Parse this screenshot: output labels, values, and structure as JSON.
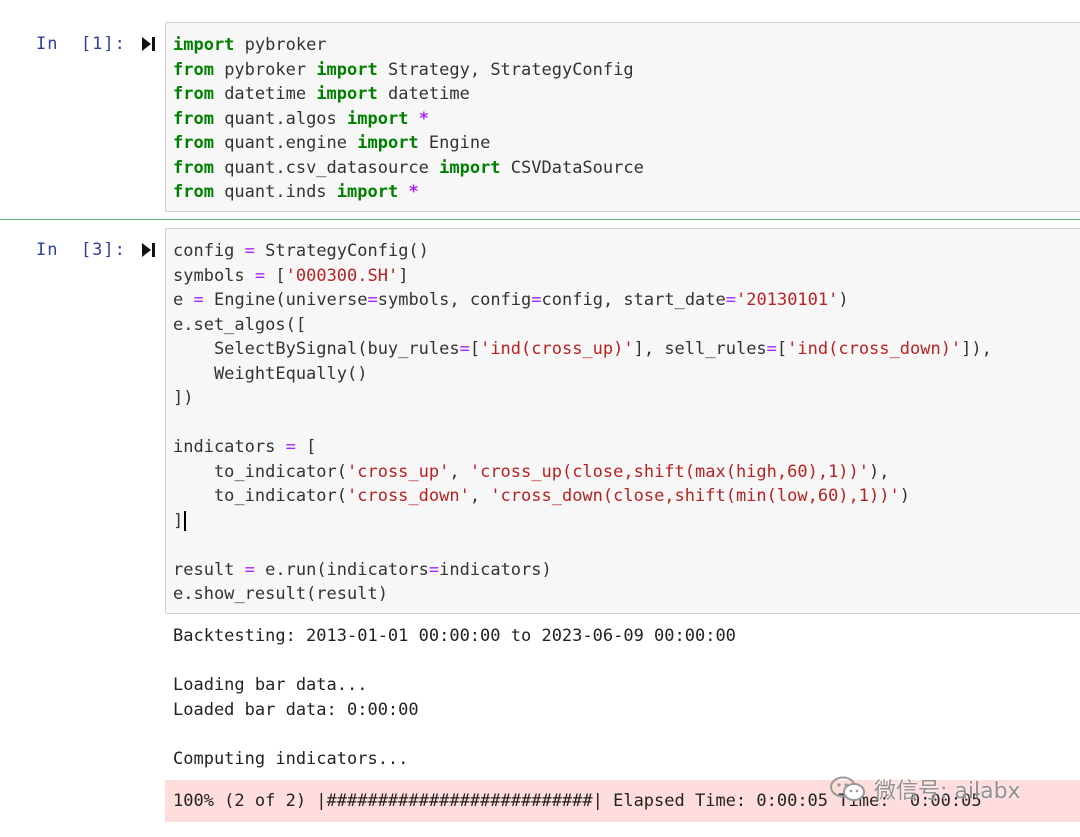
{
  "cells": [
    {
      "prompt": "In  [1]:",
      "lines": [
        [
          [
            "kw",
            "import"
          ],
          [
            "t",
            " pybroker"
          ]
        ],
        [
          [
            "kw",
            "from"
          ],
          [
            "t",
            " pybroker "
          ],
          [
            "kw",
            "import"
          ],
          [
            "t",
            " Strategy, StrategyConfig"
          ]
        ],
        [
          [
            "kw",
            "from"
          ],
          [
            "t",
            " datetime "
          ],
          [
            "kw",
            "import"
          ],
          [
            "t",
            " datetime"
          ]
        ],
        [
          [
            "kw",
            "from"
          ],
          [
            "t",
            " quant.algos "
          ],
          [
            "kw",
            "import"
          ],
          [
            "t",
            " "
          ],
          [
            "op",
            "*"
          ]
        ],
        [
          [
            "kw",
            "from"
          ],
          [
            "t",
            " quant.engine "
          ],
          [
            "kw",
            "import"
          ],
          [
            "t",
            " Engine"
          ]
        ],
        [
          [
            "kw",
            "from"
          ],
          [
            "t",
            " quant.csv_datasource "
          ],
          [
            "kw",
            "import"
          ],
          [
            "t",
            " CSVDataSource"
          ]
        ],
        [
          [
            "kw",
            "from"
          ],
          [
            "t",
            " quant.inds "
          ],
          [
            "kw",
            "import"
          ],
          [
            "t",
            " "
          ],
          [
            "op",
            "*"
          ]
        ]
      ]
    },
    {
      "prompt": "In  [3]:",
      "lines": [
        [
          [
            "t",
            "config "
          ],
          [
            "eq",
            "="
          ],
          [
            "t",
            " StrategyConfig()"
          ]
        ],
        [
          [
            "t",
            "symbols "
          ],
          [
            "eq",
            "="
          ],
          [
            "t",
            " ["
          ],
          [
            "str",
            "'000300.SH'"
          ],
          [
            "t",
            "]"
          ]
        ],
        [
          [
            "t",
            "e "
          ],
          [
            "eq",
            "="
          ],
          [
            "t",
            " Engine(universe"
          ],
          [
            "eq",
            "="
          ],
          [
            "t",
            "symbols, config"
          ],
          [
            "eq",
            "="
          ],
          [
            "t",
            "config, start_date"
          ],
          [
            "eq",
            "="
          ],
          [
            "str",
            "'20130101'"
          ],
          [
            "t",
            ")"
          ]
        ],
        [
          [
            "t",
            "e.set_algos(["
          ]
        ],
        [
          [
            "t",
            "    SelectBySignal(buy_rules"
          ],
          [
            "eq",
            "="
          ],
          [
            "t",
            "["
          ],
          [
            "str",
            "'ind(cross_up)'"
          ],
          [
            "t",
            "], sell_rules"
          ],
          [
            "eq",
            "="
          ],
          [
            "t",
            "["
          ],
          [
            "str",
            "'ind(cross_down)'"
          ],
          [
            "t",
            "]),"
          ]
        ],
        [
          [
            "t",
            "    WeightEqually()"
          ]
        ],
        [
          [
            "t",
            "])"
          ]
        ],
        [
          [
            "t",
            ""
          ]
        ],
        [
          [
            "t",
            "indicators "
          ],
          [
            "eq",
            "="
          ],
          [
            "t",
            " ["
          ]
        ],
        [
          [
            "t",
            "    to_indicator("
          ],
          [
            "str",
            "'cross_up'"
          ],
          [
            "t",
            ", "
          ],
          [
            "str",
            "'cross_up(close,shift(max(high,60),1))'"
          ],
          [
            "t",
            "),"
          ]
        ],
        [
          [
            "t",
            "    to_indicator("
          ],
          [
            "str",
            "'cross_down'"
          ],
          [
            "t",
            ", "
          ],
          [
            "str",
            "'cross_down(close,shift(min(low,60),1))'"
          ],
          [
            "t",
            ")"
          ]
        ],
        [
          [
            "t",
            "]"
          ],
          [
            "cursor",
            ""
          ]
        ],
        [
          [
            "t",
            ""
          ]
        ],
        [
          [
            "t",
            "result "
          ],
          [
            "eq",
            "="
          ],
          [
            "t",
            " e.run(indicators"
          ],
          [
            "eq",
            "="
          ],
          [
            "t",
            "indicators)"
          ]
        ],
        [
          [
            "t",
            "e.show_result(result)"
          ]
        ]
      ]
    }
  ],
  "output": {
    "lines": [
      "Backtesting: 2013-01-01 00:00:00 to 2023-06-09 00:00:00",
      "",
      "Loading bar data...",
      "Loaded bar data: 0:00:00",
      "",
      "Computing indicators..."
    ],
    "progress": "100% (2 of 2) |##########################| Elapsed Time: 0:00:05 Time:  0:00:05"
  },
  "watermark": {
    "text": "微信号: ailabx",
    "icon": "wechat-icon"
  },
  "colors": {
    "keyword": "#008000",
    "operator": "#aa22ff",
    "string": "#ba2121",
    "prompt": "#303f9f",
    "stderr_bg": "#ffdddd"
  }
}
